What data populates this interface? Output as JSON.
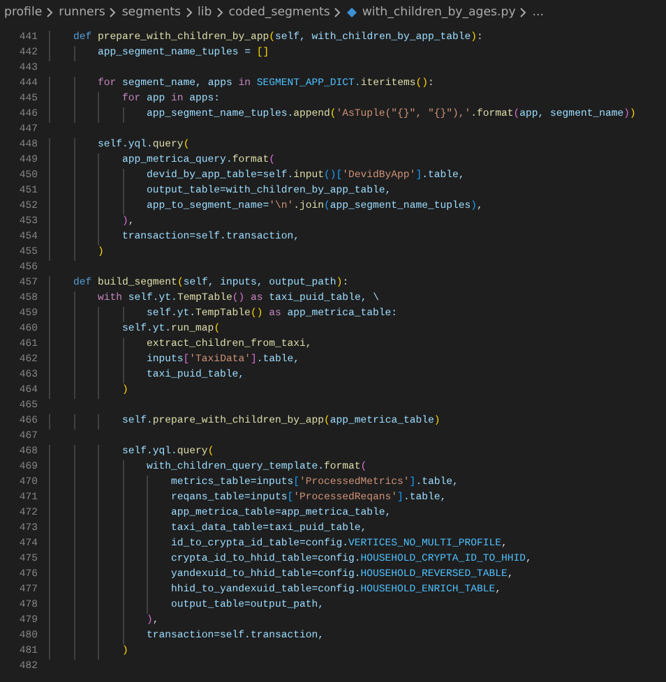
{
  "breadcrumb": [
    {
      "label": "profile",
      "kind": "folder"
    },
    {
      "label": "runners",
      "kind": "folder"
    },
    {
      "label": "segments",
      "kind": "folder"
    },
    {
      "label": "lib",
      "kind": "folder"
    },
    {
      "label": "coded_segments",
      "kind": "folder"
    },
    {
      "label": "with_children_by_ages.py",
      "kind": "file"
    },
    {
      "label": "...",
      "kind": "more"
    }
  ],
  "lines": [
    {
      "number": "441",
      "tokens": [
        {
          "text": "    def ",
          "kind": "keyword"
        },
        {
          "text": "prepare_with_children_by_app",
          "kind": "function"
        },
        {
          "text": "(",
          "kind": "paren"
        },
        {
          "text": "self, with_children_by_app_table",
          "kind": "name"
        },
        {
          "text": ")",
          "kind": "paren"
        },
        {
          "text": ":",
          "kind": "plain"
        }
      ]
    },
    {
      "number": "442",
      "tokens": [
        {
          "text": "        app_segment_name_tuples = ",
          "kind": "name"
        },
        {
          "text": "[]",
          "kind": "paren"
        }
      ]
    },
    {
      "number": "443"
    },
    {
      "number": "444",
      "tokens": [
        {
          "text": "        for ",
          "kind": "control"
        },
        {
          "text": "segment_name, apps ",
          "kind": "name"
        },
        {
          "text": "in ",
          "kind": "control"
        },
        {
          "text": "SEGMENT_APP_DICT.",
          "kind": "constant"
        },
        {
          "text": "iteritems",
          "kind": "function"
        },
        {
          "text": "()",
          "kind": "paren"
        },
        {
          "text": ":",
          "kind": "plain"
        }
      ]
    },
    {
      "number": "445",
      "tokens": [
        {
          "text": "            for ",
          "kind": "control"
        },
        {
          "text": "app ",
          "kind": "name"
        },
        {
          "text": "in ",
          "kind": "control"
        },
        {
          "text": "apps:",
          "kind": "name"
        }
      ]
    },
    {
      "number": "446",
      "tokens": [
        {
          "text": "                app_segment_name_tuples.",
          "kind": "name"
        },
        {
          "text": "append",
          "kind": "function"
        },
        {
          "text": "(",
          "kind": "paren"
        },
        {
          "text": "'AsTuple(\"{}\", \"{}\"),'",
          "kind": "string"
        },
        {
          "text": ".format",
          "kind": "function"
        },
        {
          "text": "(",
          "kind": "brace"
        },
        {
          "text": "app, segment_name",
          "kind": "name"
        },
        {
          "text": ")",
          "kind": "brace"
        },
        {
          "text": ")",
          "kind": "paren"
        }
      ]
    },
    {
      "number": "447"
    },
    {
      "number": "448",
      "tokens": [
        {
          "text": "        self.yql.",
          "kind": "name"
        },
        {
          "text": "query",
          "kind": "function"
        },
        {
          "text": "(",
          "kind": "paren"
        }
      ]
    },
    {
      "number": "449",
      "tokens": [
        {
          "text": "            app_metrica_query.",
          "kind": "name"
        },
        {
          "text": "format",
          "kind": "function"
        },
        {
          "text": "(",
          "kind": "brace"
        }
      ]
    },
    {
      "number": "450",
      "tokens": [
        {
          "text": "                devid_by_app_table=self.",
          "kind": "name"
        },
        {
          "text": "input",
          "kind": "function"
        },
        {
          "text": "()[",
          "kind": "bracket"
        },
        {
          "text": "'DevidByApp'",
          "kind": "string"
        },
        {
          "text": "]",
          "kind": "bracket"
        },
        {
          "text": ".table,",
          "kind": "name"
        }
      ]
    },
    {
      "number": "451",
      "tokens": [
        {
          "text": "                output_table=with_children_by_app_table,",
          "kind": "name"
        }
      ]
    },
    {
      "number": "452",
      "tokens": [
        {
          "text": "                app_to_segment_name=",
          "kind": "name"
        },
        {
          "text": "'\\n'",
          "kind": "string"
        },
        {
          "text": ".join",
          "kind": "function"
        },
        {
          "text": "(",
          "kind": "bracket"
        },
        {
          "text": "app_segment_name_tuples",
          "kind": "name"
        },
        {
          "text": ")",
          "kind": "bracket"
        },
        {
          "text": ",",
          "kind": "plain"
        }
      ]
    },
    {
      "number": "453",
      "tokens": [
        {
          "text": "            )",
          "kind": "brace"
        },
        {
          "text": ",",
          "kind": "plain"
        }
      ]
    },
    {
      "number": "454",
      "tokens": [
        {
          "text": "            transaction=self.transaction,",
          "kind": "name"
        }
      ]
    },
    {
      "number": "455",
      "tokens": [
        {
          "text": "        )",
          "kind": "paren"
        }
      ]
    },
    {
      "number": "456"
    },
    {
      "number": "457",
      "tokens": [
        {
          "text": "    def ",
          "kind": "keyword"
        },
        {
          "text": "build_segment",
          "kind": "function"
        },
        {
          "text": "(",
          "kind": "paren"
        },
        {
          "text": "self, inputs, output_path",
          "kind": "name"
        },
        {
          "text": ")",
          "kind": "paren"
        },
        {
          "text": ":",
          "kind": "plain"
        }
      ]
    },
    {
      "number": "458",
      "tokens": [
        {
          "text": "        with ",
          "kind": "control"
        },
        {
          "text": "self.yt.",
          "kind": "name"
        },
        {
          "text": "TempTable",
          "kind": "function"
        },
        {
          "text": "() ",
          "kind": "brace"
        },
        {
          "text": "as ",
          "kind": "control"
        },
        {
          "text": "taxi_puid_table, \\",
          "kind": "name"
        }
      ]
    },
    {
      "number": "459",
      "tokens": [
        {
          "text": "                self.yt.",
          "kind": "name"
        },
        {
          "text": "TempTable",
          "kind": "function"
        },
        {
          "text": "() ",
          "kind": "paren"
        },
        {
          "text": "as ",
          "kind": "control"
        },
        {
          "text": "app_metrica_table:",
          "kind": "name"
        }
      ]
    },
    {
      "number": "460",
      "tokens": [
        {
          "text": "            self.yt.",
          "kind": "name"
        },
        {
          "text": "run_map",
          "kind": "function"
        },
        {
          "text": "(",
          "kind": "paren"
        }
      ]
    },
    {
      "number": "461",
      "tokens": [
        {
          "text": "                extract_children_from_taxi,",
          "kind": "function"
        }
      ]
    },
    {
      "number": "462",
      "tokens": [
        {
          "text": "                inputs",
          "kind": "name"
        },
        {
          "text": "[",
          "kind": "brace"
        },
        {
          "text": "'TaxiData'",
          "kind": "string"
        },
        {
          "text": "]",
          "kind": "brace"
        },
        {
          "text": ".table,",
          "kind": "name"
        }
      ]
    },
    {
      "number": "463",
      "tokens": [
        {
          "text": "                taxi_puid_table,",
          "kind": "name"
        }
      ]
    },
    {
      "number": "464",
      "tokens": [
        {
          "text": "            )",
          "kind": "paren"
        }
      ]
    },
    {
      "number": "465"
    },
    {
      "number": "466",
      "tokens": [
        {
          "text": "            self.",
          "kind": "name"
        },
        {
          "text": "prepare_with_children_by_app",
          "kind": "function"
        },
        {
          "text": "(",
          "kind": "paren"
        },
        {
          "text": "app_metrica_table",
          "kind": "name"
        },
        {
          "text": ")",
          "kind": "paren"
        }
      ]
    },
    {
      "number": "467"
    },
    {
      "number": "468",
      "tokens": [
        {
          "text": "            self.yql.",
          "kind": "name"
        },
        {
          "text": "query",
          "kind": "function"
        },
        {
          "text": "(",
          "kind": "paren"
        }
      ]
    },
    {
      "number": "469",
      "tokens": [
        {
          "text": "                with_children_query_template.",
          "kind": "name"
        },
        {
          "text": "format",
          "kind": "function"
        },
        {
          "text": "(",
          "kind": "brace"
        }
      ]
    },
    {
      "number": "470",
      "tokens": [
        {
          "text": "                    metrics_table=inputs",
          "kind": "name"
        },
        {
          "text": "[",
          "kind": "bracket"
        },
        {
          "text": "'ProcessedMetrics'",
          "kind": "string"
        },
        {
          "text": "]",
          "kind": "bracket"
        },
        {
          "text": ".table,",
          "kind": "name"
        }
      ]
    },
    {
      "number": "471",
      "tokens": [
        {
          "text": "                    reqans_table=inputs",
          "kind": "name"
        },
        {
          "text": "[",
          "kind": "bracket"
        },
        {
          "text": "'ProcessedReqans'",
          "kind": "string"
        },
        {
          "text": "]",
          "kind": "bracket"
        },
        {
          "text": ".table,",
          "kind": "name"
        }
      ]
    },
    {
      "number": "472",
      "tokens": [
        {
          "text": "                    app_metrica_table=app_metrica_table,",
          "kind": "name"
        }
      ]
    },
    {
      "number": "473",
      "tokens": [
        {
          "text": "                    taxi_data_table=taxi_puid_table,",
          "kind": "name"
        }
      ]
    },
    {
      "number": "474",
      "tokens": [
        {
          "text": "                    id_to_crypta_id_table=config.",
          "kind": "name"
        },
        {
          "text": "VERTICES_NO_MULTI_PROFILE",
          "kind": "constant"
        },
        {
          "text": ",",
          "kind": "plain"
        }
      ]
    },
    {
      "number": "475",
      "tokens": [
        {
          "text": "                    crypta_id_to_hhid_table=config.",
          "kind": "name"
        },
        {
          "text": "HOUSEHOLD_CRYPTA_ID_TO_HHID",
          "kind": "constant"
        },
        {
          "text": ",",
          "kind": "plain"
        }
      ]
    },
    {
      "number": "476",
      "tokens": [
        {
          "text": "                    yandexuid_to_hhid_table=config.",
          "kind": "name"
        },
        {
          "text": "HOUSEHOLD_REVERSED_TABLE",
          "kind": "constant"
        },
        {
          "text": ",",
          "kind": "plain"
        }
      ]
    },
    {
      "number": "477",
      "tokens": [
        {
          "text": "                    hhid_to_yandexuid_table=config.",
          "kind": "name"
        },
        {
          "text": "HOUSEHOLD_ENRICH_TABLE",
          "kind": "constant"
        },
        {
          "text": ",",
          "kind": "plain"
        }
      ]
    },
    {
      "number": "478",
      "tokens": [
        {
          "text": "                    output_table=output_path,",
          "kind": "name"
        }
      ]
    },
    {
      "number": "479",
      "tokens": [
        {
          "text": "                )",
          "kind": "brace"
        },
        {
          "text": ",",
          "kind": "plain"
        }
      ]
    },
    {
      "number": "480",
      "tokens": [
        {
          "text": "                transaction=self.transaction,",
          "kind": "name"
        }
      ]
    },
    {
      "number": "481",
      "tokens": [
        {
          "text": "            )",
          "kind": "paren"
        }
      ]
    },
    {
      "number": "482"
    }
  ]
}
